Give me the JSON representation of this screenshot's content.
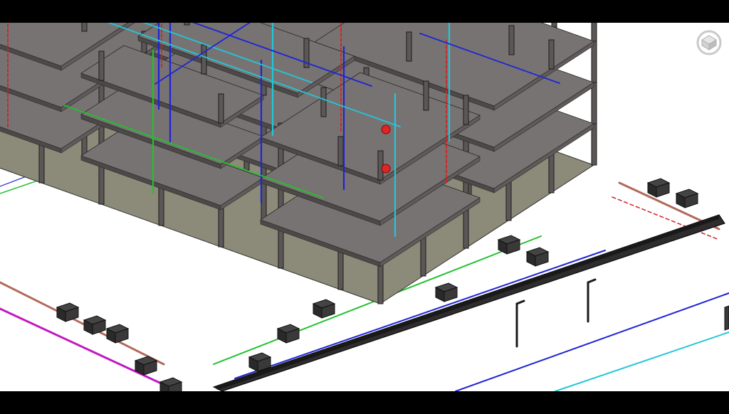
{
  "viewport": {
    "view_mode": "3D isometric",
    "visual_style": "Shaded",
    "background": "#ffffff"
  },
  "model": {
    "description_elements": [
      "slab",
      "column",
      "beam",
      "duct",
      "pipe",
      "equipment",
      "manhole",
      "lamp-post"
    ],
    "colors": {
      "slab_top": "#777372",
      "slab_side": "#4c4948",
      "column": "#5b5756",
      "column_edge": "#1c1b1b",
      "floor_interior": "#8c8a78",
      "pipe_blue": "#1f24d6",
      "pipe_cyan": "#23c6d8",
      "pipe_green": "#21c12f",
      "pipe_red_dash": "#d62020",
      "pipe_magenta": "#c218c2",
      "pipe_brown": "#b06a5a",
      "trench_dark": "#2e2c2c"
    }
  },
  "navigation": {
    "viewcube_icon": "view-cube-icon",
    "viewcube_color": "#c9c9c9"
  }
}
